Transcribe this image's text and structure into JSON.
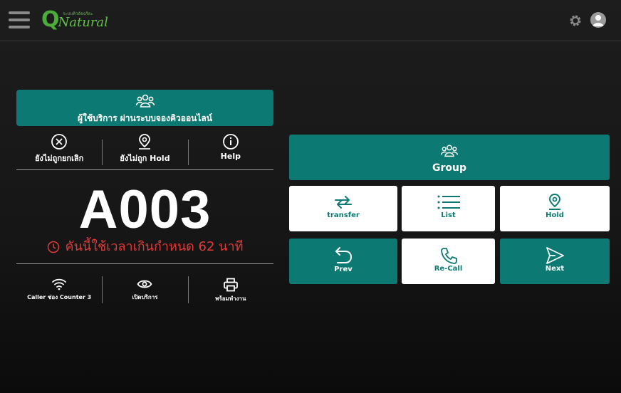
{
  "header": {
    "logo_q": "Q",
    "logo_name": "Natural",
    "logo_tagline": "ระบบคิวอัจฉริยะ"
  },
  "service_banner": {
    "label": "ผู้ใช้บริการ ผ่านระบบจองคิวออนไลน์"
  },
  "actions": [
    {
      "label": "ยังไม่ถูกยกเลิก",
      "icon": "cancel-icon"
    },
    {
      "label": "ยังไม่ถูก Hold",
      "icon": "location-pin-icon"
    },
    {
      "label": "Help",
      "icon": "info-icon"
    }
  ],
  "ticket": {
    "number": "A003"
  },
  "overdue": {
    "text": "คันนี้ใช้เวลาเกินกำหนด 62 นาที"
  },
  "status": [
    {
      "label": "Caller ช่อง Counter 3",
      "icon": "wifi-icon"
    },
    {
      "label": "เปิดบริการ",
      "icon": "eye-icon"
    },
    {
      "label": "พร้อมทำงาน",
      "icon": "printer-icon"
    }
  ],
  "buttons": {
    "group": "Group",
    "transfer": "transfer",
    "list": "List",
    "hold": "Hold",
    "prev": "Prev",
    "recall": "Re-Call",
    "next": "Next"
  },
  "colors": {
    "teal": "#0c7a73",
    "alert_red": "#e23a3a",
    "logo_green": "#4cab3a"
  }
}
